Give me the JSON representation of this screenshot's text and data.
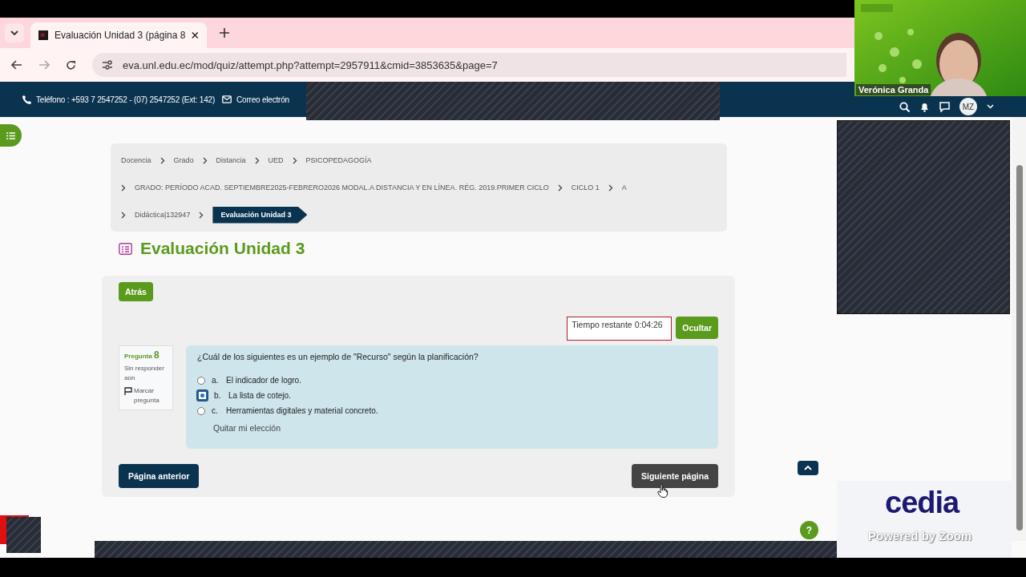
{
  "browser": {
    "tab": {
      "title": "Evaluación Unidad 3 (página 8"
    },
    "url": "eva.unl.edu.ec/mod/quiz/attempt.php?attempt=2957911&cmid=3853635&page=7"
  },
  "header": {
    "phone": "Teléfono : +593 7 2547252 - (07) 2547252 (Ext: 142)",
    "email": "Correo electrón",
    "avatar": "MZ"
  },
  "breadcrumb": [
    [
      {
        "label": "Docencia",
        "current": false
      },
      {
        "label": "Grado",
        "current": false
      },
      {
        "label": "Distancia",
        "current": false
      },
      {
        "label": "UED",
        "current": false
      },
      {
        "label": "PSICOPEDAGOGÍA",
        "current": false
      }
    ],
    [
      {
        "label": "GRADO: PERÍODO ACAD. SEPTIEMBRE2025-FEBRERO2026 MODAL.A DISTANCIA Y EN LÍNEA. RÉG. 2019.PRIMER CICLO",
        "current": false
      },
      {
        "label": "CICLO 1",
        "current": false
      },
      {
        "label": "A",
        "current": false
      }
    ],
    [
      {
        "label": "Didáctica|132947",
        "current": false
      },
      {
        "label": "Evaluación Unidad 3",
        "current": true
      }
    ]
  ],
  "page_title": "Evaluación Unidad 3",
  "quiz": {
    "back_button": "Atrás",
    "timer": "Tiempo restante 0:04:26",
    "hide_button": "Ocultar",
    "question": {
      "label": "Pregunta",
      "number": "8",
      "status": "Sin responder aún",
      "flag": "Marcar pregunta",
      "text": "¿Cuál de los siguientes es un ejemplo de \"Recurso\" según la planificación?",
      "options": [
        {
          "letter": "a.",
          "text": "El indicador de logro.",
          "selected": false
        },
        {
          "letter": "b.",
          "text": "La lista de cotejo.",
          "selected": true
        },
        {
          "letter": "c.",
          "text": "Herramientas digitales y material concreto.",
          "selected": false
        }
      ],
      "clear": "Quitar mi elección"
    },
    "prev_button": "Página anterior",
    "next_button": "Siguiente página"
  },
  "help": "?",
  "video": {
    "name": "Verónica Granda"
  },
  "overlay": {
    "brand": "cedia",
    "powered": "Powered by Zoom"
  }
}
